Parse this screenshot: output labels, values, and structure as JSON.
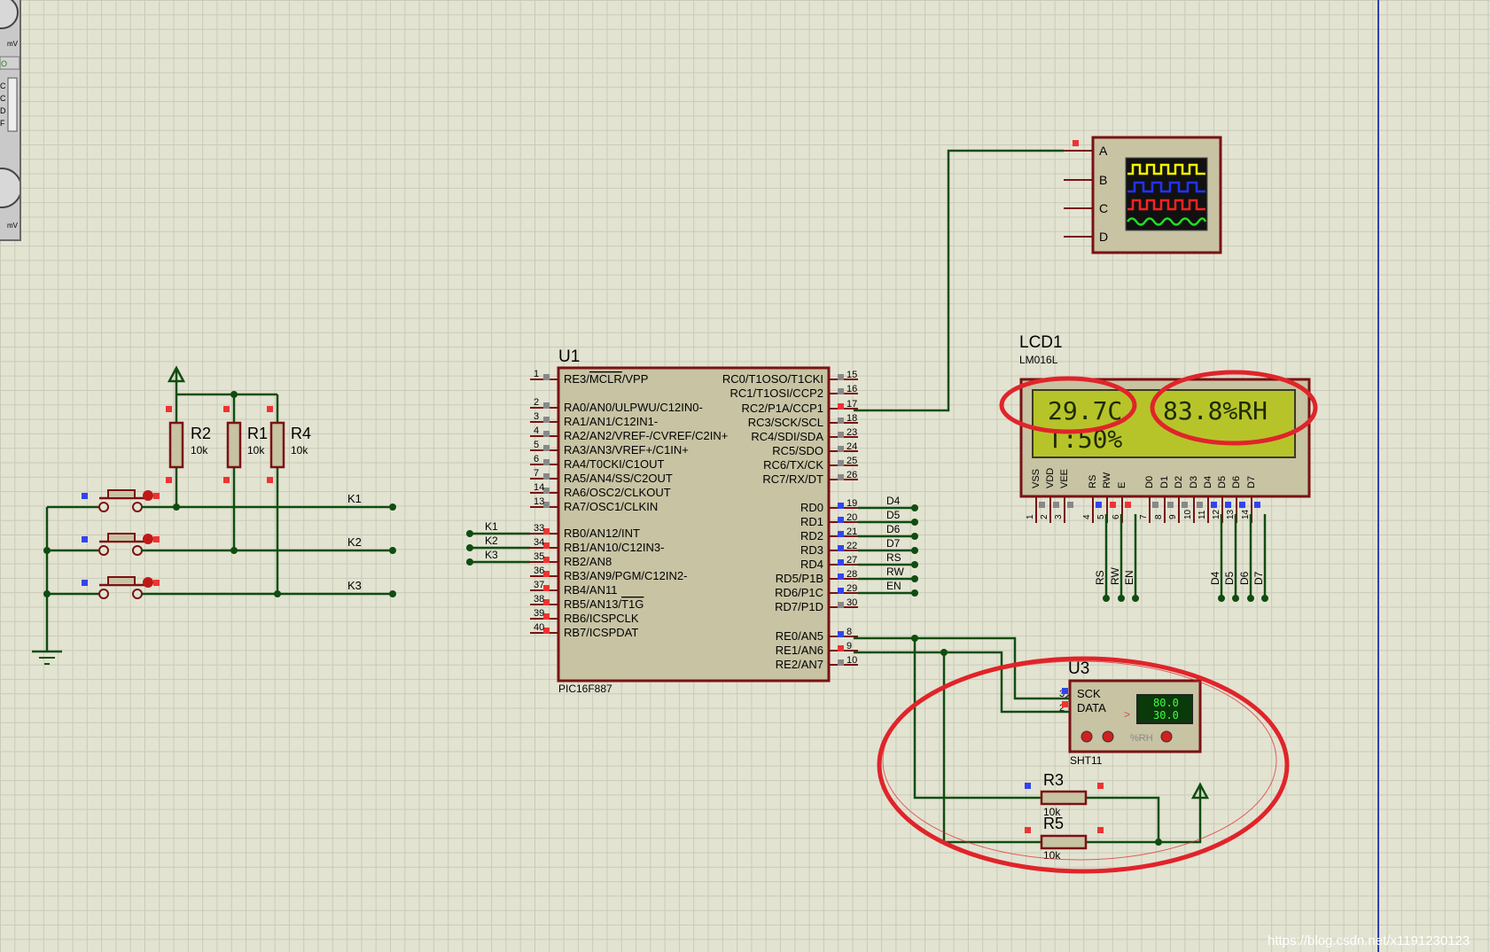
{
  "sidebar": {
    "unit_top": "mV",
    "unit_bottom": "mV",
    "letters": [
      "C",
      "C",
      "D",
      "F"
    ]
  },
  "oscilloscope": {
    "channels": [
      "A",
      "B",
      "C",
      "D"
    ]
  },
  "lcd": {
    "ref": "LCD1",
    "model": "LM016L",
    "line1_left": "29.7C",
    "line1_right": "83.8%RH",
    "line2": "T:50%",
    "pin_labels": [
      "VSS",
      "VDD",
      "VEE",
      "RS",
      "RW",
      "E",
      "D0",
      "D1",
      "D2",
      "D3",
      "D4",
      "D5",
      "D6",
      "D7"
    ],
    "pin_numbers": [
      "1",
      "2",
      "3",
      "4",
      "5",
      "6",
      "7",
      "8",
      "9",
      "10",
      "11",
      "12",
      "13",
      "14"
    ],
    "net_labels_left": [
      "RS",
      "RW",
      "EN"
    ],
    "net_labels_right": [
      "D4",
      "D5",
      "D6",
      "D7"
    ]
  },
  "mcu": {
    "ref": "U1",
    "model": "PIC16F887",
    "left_pins": [
      {
        "num": "1",
        "name": "RE3/MCLR/VPP"
      },
      {
        "num": "2",
        "name": "RA0/AN0/ULPWU/C12IN0-"
      },
      {
        "num": "3",
        "name": "RA1/AN1/C12IN1-"
      },
      {
        "num": "4",
        "name": "RA2/AN2/VREF-/CVREF/C2IN+"
      },
      {
        "num": "5",
        "name": "RA3/AN3/VREF+/C1IN+"
      },
      {
        "num": "6",
        "name": "RA4/T0CKI/C1OUT"
      },
      {
        "num": "7",
        "name": "RA5/AN4/SS/C2OUT"
      },
      {
        "num": "14",
        "name": "RA6/OSC2/CLKOUT"
      },
      {
        "num": "13",
        "name": "RA7/OSC1/CLKIN"
      },
      {
        "num": "33",
        "name": "RB0/AN12/INT"
      },
      {
        "num": "34",
        "name": "RB1/AN10/C12IN3-"
      },
      {
        "num": "35",
        "name": "RB2/AN8"
      },
      {
        "num": "36",
        "name": "RB3/AN9/PGM/C12IN2-"
      },
      {
        "num": "37",
        "name": "RB4/AN11"
      },
      {
        "num": "38",
        "name": "RB5/AN13/T1G"
      },
      {
        "num": "39",
        "name": "RB6/ICSPCLK"
      },
      {
        "num": "40",
        "name": "RB7/ICSPDAT"
      }
    ],
    "right_pins": [
      {
        "num": "15",
        "name": "RC0/T1OSO/T1CKI"
      },
      {
        "num": "16",
        "name": "RC1/T1OSI/CCP2"
      },
      {
        "num": "17",
        "name": "RC2/P1A/CCP1"
      },
      {
        "num": "18",
        "name": "RC3/SCK/SCL"
      },
      {
        "num": "23",
        "name": "RC4/SDI/SDA"
      },
      {
        "num": "24",
        "name": "RC5/SDO"
      },
      {
        "num": "25",
        "name": "RC6/TX/CK"
      },
      {
        "num": "26",
        "name": "RC7/RX/DT"
      },
      {
        "num": "19",
        "name": "RD0"
      },
      {
        "num": "20",
        "name": "RD1"
      },
      {
        "num": "21",
        "name": "RD2"
      },
      {
        "num": "22",
        "name": "RD3"
      },
      {
        "num": "27",
        "name": "RD4"
      },
      {
        "num": "28",
        "name": "RD5/P1B"
      },
      {
        "num": "29",
        "name": "RD6/P1C"
      },
      {
        "num": "30",
        "name": "RD7/P1D"
      },
      {
        "num": "8",
        "name": "RE0/AN5"
      },
      {
        "num": "9",
        "name": "RE1/AN6"
      },
      {
        "num": "10",
        "name": "RE2/AN7"
      }
    ],
    "port_d_nets": [
      "D4",
      "D5",
      "D6",
      "D7",
      "RS",
      "RW",
      "EN"
    ],
    "port_b_nets": [
      "K1",
      "K2",
      "K3"
    ]
  },
  "resistors_top": [
    {
      "ref": "R2",
      "value": "10k"
    },
    {
      "ref": "R1",
      "value": "10k"
    },
    {
      "ref": "R4",
      "value": "10k"
    }
  ],
  "buttons": [
    "K1",
    "K2",
    "K3"
  ],
  "sensor": {
    "ref": "U3",
    "model": "SHT11",
    "pin_sck": "SCK",
    "pin_data": "DATA",
    "pin_sck_num": "3",
    "pin_data_num": "2",
    "humidity": "80.0",
    "temperature": "30.0",
    "unit_label": "%RH",
    "arrow": ">"
  },
  "resistors_bottom": [
    {
      "ref": "R3",
      "value": "10k"
    },
    {
      "ref": "R5",
      "value": "10k"
    }
  ],
  "watermark": "https://blog.csdn.net/x1191230123",
  "colors": {
    "wire": "#0f4d10",
    "component_fill": "#c7c3a3",
    "component_border": "#7a1212",
    "lcd_screen": "#b6c42a",
    "highlight": "#e0242a",
    "pin_red": "#ee3333",
    "pin_blue": "#3344ee"
  }
}
